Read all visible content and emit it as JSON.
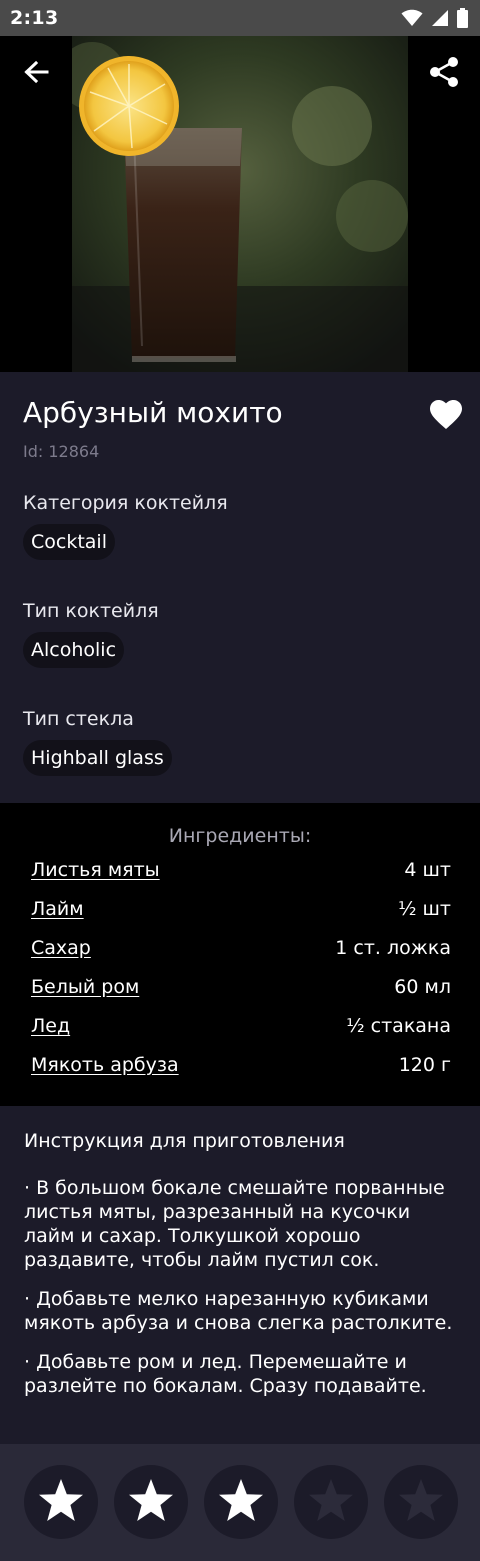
{
  "status_bar": {
    "time": "2:13"
  },
  "header": {
    "back_icon": "arrow-left-icon",
    "share_icon": "share-icon"
  },
  "drink": {
    "title": "Арбузный мохито",
    "id_text": "Id: 12864",
    "favorite_icon": "heart-icon"
  },
  "details": {
    "category_label": "Категория коктейля",
    "category_value": "Cocktail",
    "type_label": "Тип коктейля",
    "type_value": "Alcoholic",
    "glass_label": "Тип стекла",
    "glass_value": "Highball glass"
  },
  "ingredients": {
    "header": "Ингредиенты:",
    "items": [
      {
        "name": "Листья мяты",
        "amount": "4 шт"
      },
      {
        "name": "Лайм",
        "amount": "½ шт"
      },
      {
        "name": "Сахар",
        "amount": "1 ст. ложка"
      },
      {
        "name": "Белый ром",
        "amount": "60 мл"
      },
      {
        "name": "Лед",
        "amount": "½ стакана"
      },
      {
        "name": "Мякоть арбуза",
        "amount": "120 г"
      }
    ]
  },
  "instructions": {
    "title": "Инструкция для приготовления",
    "steps": [
      "· В большом бокале смешайте порванные листья мяты, разрезанный на кусочки лайм и сахар. Толкушкой хорошо раздавите, чтобы лайм пустил сок.",
      "· Добавьте мелко нарезанную кубиками мякоть арбуза и снова слегка растолките.",
      "· Добавьте ром и лед. Перемешайте и разлейте по бокалам. Сразу подавайте."
    ]
  },
  "rating": {
    "max": 5,
    "value": 3,
    "filled_color": "#ffffff",
    "empty_color": "#2c2b3a"
  },
  "colors": {
    "panel": "#1c1b29",
    "background": "#000000",
    "muted_text": "#7d7b8c"
  }
}
